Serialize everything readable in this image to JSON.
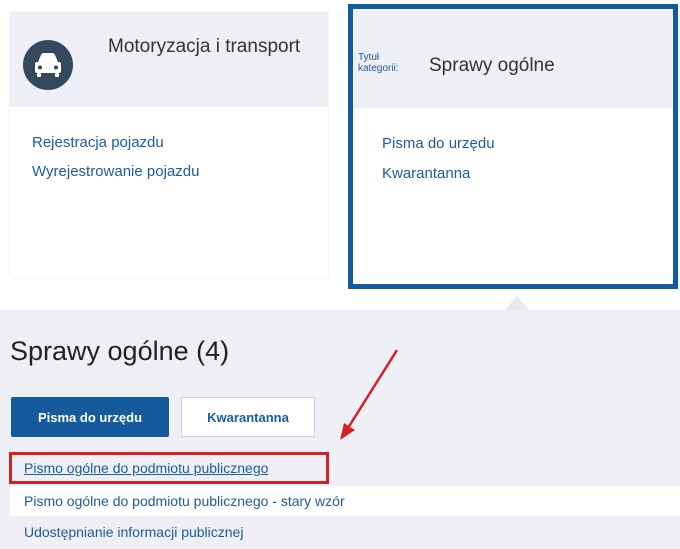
{
  "categories": {
    "left": {
      "title": "Motoryzacja i transport",
      "icon": "car-icon",
      "links": [
        "Rejestracja pojazdu",
        "Wyrejestrowanie pojazdu"
      ]
    },
    "right": {
      "label": "Tytuł kategorii:",
      "title": "Sprawy ogólne",
      "links": [
        "Pisma do urzędu",
        "Kwarantanna"
      ]
    }
  },
  "section": {
    "title": "Sprawy ogólne (4)",
    "tabs": [
      {
        "label": "Pisma do urzędu",
        "active": true
      },
      {
        "label": "Kwarantanna",
        "active": false
      }
    ],
    "items": [
      "Pismo ogólne do podmiotu publicznego",
      "Pismo ogólne do podmiotu publicznego - stary wzór",
      "Udostępnianie informacji publicznej"
    ]
  },
  "colors": {
    "accent": "#155b9b",
    "link": "#1d5ba3",
    "highlight": "#d42027",
    "panel": "#eef0f5"
  }
}
